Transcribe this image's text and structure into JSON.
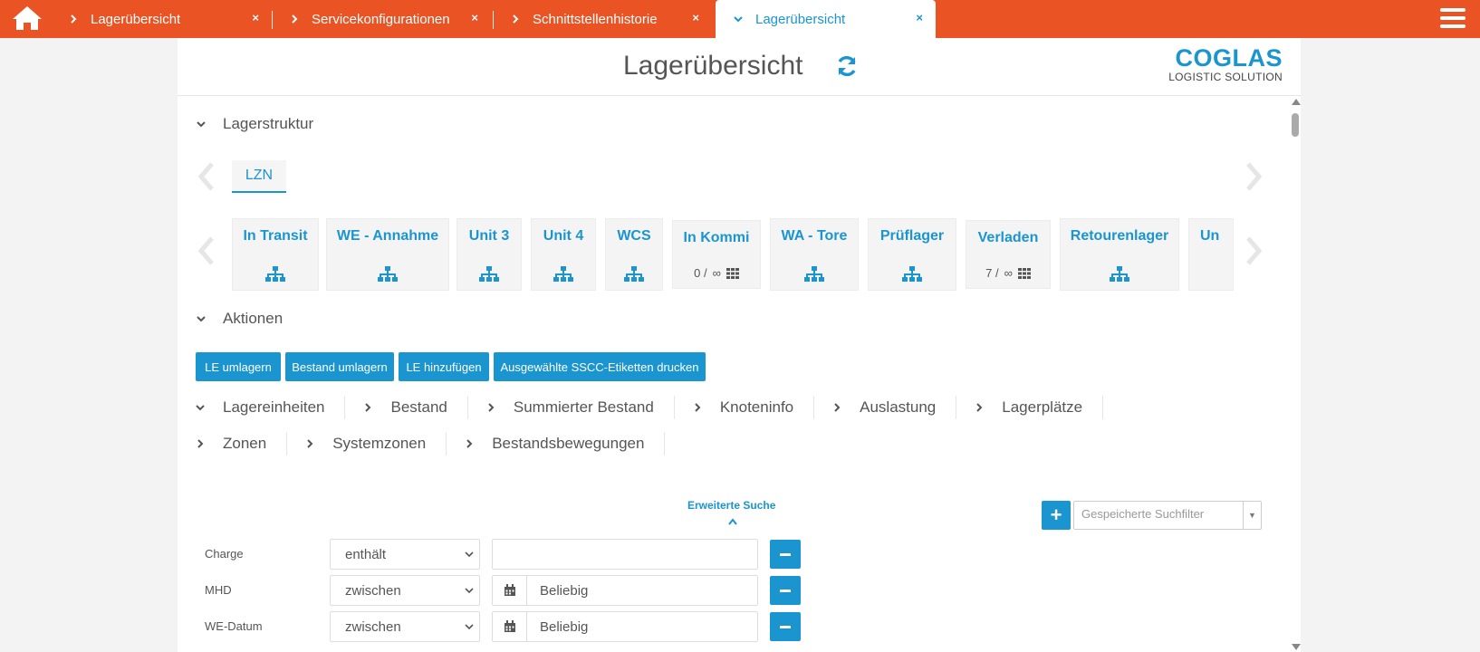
{
  "tabs": [
    {
      "label": "Lagerübersicht",
      "active": false
    },
    {
      "label": "Servicekonfigurationen",
      "active": false
    },
    {
      "label": "Schnittstellenhistorie",
      "active": false
    },
    {
      "label": "Lagerübersicht",
      "active": true
    }
  ],
  "tab_close": "×",
  "header": {
    "title": "Lagerübersicht"
  },
  "logo": {
    "brand": "COGLAS",
    "sub": "LOGISTIC SOLUTION"
  },
  "sections": {
    "lagerstruktur": "Lagerstruktur",
    "aktionen": "Aktionen"
  },
  "area_tab": "LZN",
  "tiles": [
    {
      "name": "In Transit",
      "kind": "tree"
    },
    {
      "name": "WE - Annahme",
      "kind": "tree"
    },
    {
      "name": "Unit 3",
      "kind": "tree"
    },
    {
      "name": "Unit 4",
      "kind": "tree"
    },
    {
      "name": "WCS",
      "kind": "tree"
    },
    {
      "name": "In Kommi",
      "kind": "capacity",
      "count": "0 /",
      "cap": "∞"
    },
    {
      "name": "WA - Tore",
      "kind": "tree"
    },
    {
      "name": "Prüflager",
      "kind": "tree"
    },
    {
      "name": "Verladen",
      "kind": "capacity",
      "count": "7 /",
      "cap": "∞"
    },
    {
      "name": "Retourenlager",
      "kind": "tree"
    },
    {
      "name": "Un",
      "kind": "partial"
    }
  ],
  "actions": [
    "LE umlagern",
    "Bestand umlagern",
    "LE hinzufügen",
    "Ausgewählte SSCC-Etiketten drucken"
  ],
  "accordion_row1": [
    {
      "label": "Lagereinheiten",
      "open": true
    },
    {
      "label": "Bestand",
      "open": false
    },
    {
      "label": "Summierter Bestand",
      "open": false
    },
    {
      "label": "Knoteninfo",
      "open": false
    },
    {
      "label": "Auslastung",
      "open": false
    },
    {
      "label": "Lagerplätze",
      "open": false
    }
  ],
  "accordion_row2": [
    {
      "label": "Zonen",
      "open": false
    },
    {
      "label": "Systemzonen",
      "open": false
    },
    {
      "label": "Bestandsbewegungen",
      "open": false
    }
  ],
  "search": {
    "advanced_label": "Erweiterte Suche",
    "add_label": "+",
    "saved_filter_placeholder": "Gespeicherte Suchfilter",
    "dd_glyph": "▼"
  },
  "filters": [
    {
      "label": "Charge",
      "operator": "enthält",
      "value": "",
      "date": false
    },
    {
      "label": "MHD",
      "operator": "zwischen",
      "value": "Beliebig",
      "date": true
    },
    {
      "label": "WE-Datum",
      "operator": "zwischen",
      "value": "Beliebig",
      "date": true
    }
  ],
  "colors": {
    "brand_orange": "#ea5323",
    "accent_blue": "#1a95d0"
  }
}
